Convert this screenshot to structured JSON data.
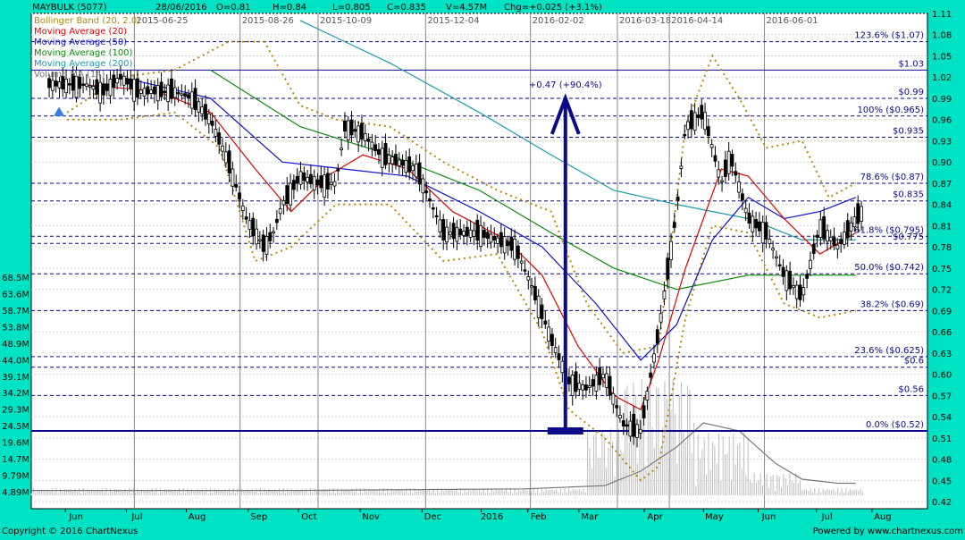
{
  "header": {
    "symbol": "MAYBULK (5077)",
    "date": "28/06/2016",
    "open": "O=0.81",
    "high": "H=0.84",
    "low": "L=0.805",
    "close": "C=0.835",
    "volume": "V=4.57M",
    "change": "Chg=+0.025 (+3.1%)"
  },
  "legend": [
    {
      "label": "Bollinger Band (20, 2.0)",
      "color": "#b8860b"
    },
    {
      "label": "Moving Average (20)",
      "color": "#e00000"
    },
    {
      "label": "Moving Average (50)",
      "color": "#1010d0"
    },
    {
      "label": "Moving Average (100)",
      "color": "#0a8a0a"
    },
    {
      "label": "Moving Average (200)",
      "color": "#1a9aaa"
    },
    {
      "label": "Volume MA (14)",
      "color": "#777777"
    }
  ],
  "footer": {
    "copyright": "Copyright © 2016 ChartNexus",
    "powered": "Powered by www.chartnexus.com"
  },
  "colors": {
    "background": "#00e2c4",
    "plot_background": "#ffffff",
    "candle": "#000000",
    "level_line": "#0a0a8a",
    "arrow": "#0a0a8a"
  },
  "chart_data": {
    "type": "candlestick",
    "title": "MAYBULK (5077)",
    "ylim": [
      0.41,
      1.11
    ],
    "y_ticks": [
      "0.42",
      "0.45",
      "0.48",
      "0.51",
      "0.54",
      "0.57",
      "0.60",
      "0.63",
      "0.66",
      "0.69",
      "0.72",
      "0.75",
      "0.78",
      "0.81",
      "0.84",
      "0.87",
      "0.90",
      "0.93",
      "0.96",
      "0.99",
      "1.02",
      "1.05",
      "1.08",
      "1.11"
    ],
    "volume_ticks": [
      "68.5M",
      "63.6M",
      "58.7M",
      "53.8M",
      "48.9M",
      "44.0M",
      "39.1M",
      "34.2M",
      "29.3M",
      "24.5M",
      "19.6M",
      "14.7M",
      "9.79M",
      "4.89M"
    ],
    "x_months": [
      "Jun",
      "Jul",
      "Aug",
      "Sep",
      "Oct",
      "Nov",
      "Dec",
      "2016",
      "Feb",
      "Mar",
      "Apr",
      "May",
      "Jun",
      "Jul",
      "Aug"
    ],
    "date_markers": [
      "2015-06-25",
      "2015-08-26",
      "2015-10-09",
      "2015-12-04",
      "2016-02-02",
      "2016-03-18",
      "2016-04-14",
      "2016-06-01"
    ],
    "levels": [
      {
        "label": "123.6%  ($1.07)",
        "value": 1.07,
        "dashed": true
      },
      {
        "label": "$1.03",
        "value": 1.03,
        "dashed": false
      },
      {
        "label": "$0.99",
        "value": 0.99,
        "dashed": true
      },
      {
        "label": "100%  ($0.965)",
        "value": 0.965,
        "dashed": true
      },
      {
        "label": "$0.935",
        "value": 0.935,
        "dashed": true
      },
      {
        "label": "78.6%  ($0.87)",
        "value": 0.87,
        "dashed": true
      },
      {
        "label": "$0.835",
        "value": 0.845,
        "dashed": true
      },
      {
        "label": "61.8%  ($0.795)",
        "value": 0.795,
        "dashed": true
      },
      {
        "label": "$0.775",
        "value": 0.785,
        "dashed": true
      },
      {
        "label": "50.0%  ($0.742)",
        "value": 0.742,
        "dashed": true
      },
      {
        "label": "38.2%  ($0.69)",
        "value": 0.69,
        "dashed": true
      },
      {
        "label": "23.6%  ($0.625)",
        "value": 0.625,
        "dashed": true
      },
      {
        "label": "$0.6",
        "value": 0.61,
        "dashed": true
      },
      {
        "label": "$0.56",
        "value": 0.57,
        "dashed": true
      },
      {
        "label": "0.0%  ($0.52)",
        "value": 0.52,
        "dashed": false
      }
    ],
    "annotation": {
      "label": "+0.47 (+90.4%)",
      "from": 0.52,
      "to": 0.99
    },
    "price_path": [
      [
        0.0,
        1.0
      ],
      [
        0.02,
        1.01
      ],
      [
        0.04,
        1.01
      ],
      [
        0.06,
        1.01
      ],
      [
        0.08,
        1.0
      ],
      [
        0.1,
        1.02
      ],
      [
        0.12,
        1.0
      ],
      [
        0.14,
        1.0
      ],
      [
        0.16,
        1.0
      ],
      [
        0.18,
        0.99
      ],
      [
        0.2,
        0.96
      ],
      [
        0.22,
        0.9
      ],
      [
        0.24,
        0.82
      ],
      [
        0.26,
        0.78
      ],
      [
        0.27,
        0.8
      ],
      [
        0.28,
        0.84
      ],
      [
        0.3,
        0.88
      ],
      [
        0.32,
        0.87
      ],
      [
        0.34,
        0.87
      ],
      [
        0.35,
        0.95
      ],
      [
        0.37,
        0.94
      ],
      [
        0.39,
        0.91
      ],
      [
        0.41,
        0.9
      ],
      [
        0.43,
        0.89
      ],
      [
        0.44,
        0.86
      ],
      [
        0.46,
        0.8
      ],
      [
        0.48,
        0.8
      ],
      [
        0.5,
        0.8
      ],
      [
        0.52,
        0.79
      ],
      [
        0.54,
        0.78
      ],
      [
        0.56,
        0.72
      ],
      [
        0.58,
        0.65
      ],
      [
        0.6,
        0.59
      ],
      [
        0.62,
        0.58
      ],
      [
        0.64,
        0.6
      ],
      [
        0.66,
        0.53
      ],
      [
        0.68,
        0.52
      ],
      [
        0.7,
        0.66
      ],
      [
        0.72,
        0.83
      ],
      [
        0.73,
        0.95
      ],
      [
        0.75,
        0.97
      ],
      [
        0.77,
        0.87
      ],
      [
        0.78,
        0.91
      ],
      [
        0.8,
        0.82
      ],
      [
        0.82,
        0.8
      ],
      [
        0.84,
        0.74
      ],
      [
        0.86,
        0.71
      ],
      [
        0.88,
        0.81
      ],
      [
        0.9,
        0.78
      ],
      [
        0.92,
        0.82
      ],
      [
        0.93,
        0.835
      ]
    ],
    "ma20": [
      [
        0.05,
        1.01
      ],
      [
        0.14,
        1.0
      ],
      [
        0.2,
        0.97
      ],
      [
        0.25,
        0.89
      ],
      [
        0.29,
        0.83
      ],
      [
        0.33,
        0.88
      ],
      [
        0.37,
        0.91
      ],
      [
        0.42,
        0.89
      ],
      [
        0.47,
        0.83
      ],
      [
        0.53,
        0.79
      ],
      [
        0.57,
        0.74
      ],
      [
        0.61,
        0.64
      ],
      [
        0.65,
        0.57
      ],
      [
        0.68,
        0.55
      ],
      [
        0.7,
        0.62
      ],
      [
        0.73,
        0.75
      ],
      [
        0.77,
        0.89
      ],
      [
        0.8,
        0.88
      ],
      [
        0.84,
        0.82
      ],
      [
        0.88,
        0.77
      ],
      [
        0.92,
        0.8
      ]
    ],
    "ma50": [
      [
        0.1,
        1.02
      ],
      [
        0.2,
        0.99
      ],
      [
        0.28,
        0.9
      ],
      [
        0.35,
        0.89
      ],
      [
        0.42,
        0.88
      ],
      [
        0.5,
        0.83
      ],
      [
        0.57,
        0.78
      ],
      [
        0.63,
        0.7
      ],
      [
        0.68,
        0.62
      ],
      [
        0.72,
        0.67
      ],
      [
        0.76,
        0.79
      ],
      [
        0.8,
        0.85
      ],
      [
        0.84,
        0.82
      ],
      [
        0.88,
        0.83
      ],
      [
        0.92,
        0.85
      ]
    ],
    "ma100": [
      [
        0.2,
        1.03
      ],
      [
        0.3,
        0.95
      ],
      [
        0.4,
        0.91
      ],
      [
        0.5,
        0.86
      ],
      [
        0.58,
        0.8
      ],
      [
        0.65,
        0.75
      ],
      [
        0.72,
        0.72
      ],
      [
        0.8,
        0.74
      ],
      [
        0.86,
        0.74
      ],
      [
        0.92,
        0.74
      ]
    ],
    "ma200": [
      [
        0.3,
        1.1
      ],
      [
        0.4,
        1.04
      ],
      [
        0.5,
        0.97
      ],
      [
        0.58,
        0.91
      ],
      [
        0.65,
        0.86
      ],
      [
        0.72,
        0.84
      ],
      [
        0.8,
        0.82
      ],
      [
        0.86,
        0.79
      ],
      [
        0.92,
        0.79
      ]
    ],
    "bb_upper": [
      [
        0.04,
        0.97
      ],
      [
        0.1,
        1.02
      ],
      [
        0.16,
        1.03
      ],
      [
        0.22,
        1.07
      ],
      [
        0.26,
        1.07
      ],
      [
        0.3,
        0.98
      ],
      [
        0.34,
        0.96
      ],
      [
        0.4,
        0.95
      ],
      [
        0.46,
        0.9
      ],
      [
        0.52,
        0.86
      ],
      [
        0.58,
        0.83
      ],
      [
        0.62,
        0.7
      ],
      [
        0.66,
        0.63
      ],
      [
        0.7,
        0.64
      ],
      [
        0.73,
        0.95
      ],
      [
        0.76,
        1.05
      ],
      [
        0.79,
        0.99
      ],
      [
        0.82,
        0.92
      ],
      [
        0.86,
        0.93
      ],
      [
        0.89,
        0.85
      ],
      [
        0.92,
        0.87
      ]
    ],
    "bb_lower": [
      [
        0.04,
        0.96
      ],
      [
        0.1,
        0.96
      ],
      [
        0.16,
        0.97
      ],
      [
        0.21,
        0.92
      ],
      [
        0.25,
        0.76
      ],
      [
        0.29,
        0.78
      ],
      [
        0.34,
        0.84
      ],
      [
        0.4,
        0.84
      ],
      [
        0.46,
        0.76
      ],
      [
        0.52,
        0.77
      ],
      [
        0.57,
        0.66
      ],
      [
        0.6,
        0.55
      ],
      [
        0.64,
        0.51
      ],
      [
        0.68,
        0.45
      ],
      [
        0.7,
        0.47
      ],
      [
        0.73,
        0.68
      ],
      [
        0.76,
        0.81
      ],
      [
        0.8,
        0.8
      ],
      [
        0.84,
        0.7
      ],
      [
        0.88,
        0.68
      ],
      [
        0.92,
        0.69
      ]
    ],
    "volume_ma": [
      [
        0.0,
        0.6
      ],
      [
        0.3,
        0.6
      ],
      [
        0.55,
        0.8
      ],
      [
        0.64,
        1.2
      ],
      [
        0.68,
        3.0
      ],
      [
        0.72,
        6.0
      ],
      [
        0.75,
        9.0
      ],
      [
        0.79,
        8.0
      ],
      [
        0.83,
        4.0
      ],
      [
        0.86,
        2.0
      ],
      [
        0.9,
        1.5
      ],
      [
        0.92,
        1.5
      ]
    ]
  }
}
